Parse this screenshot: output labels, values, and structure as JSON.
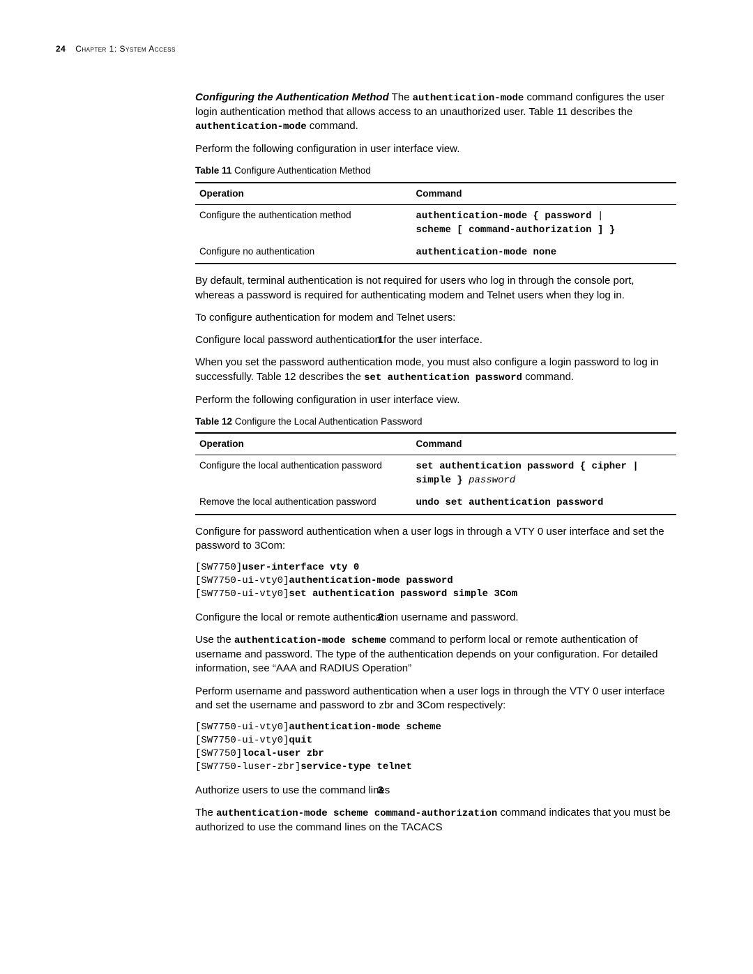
{
  "header": {
    "page_number": "24",
    "chapter": "Chapter 1: System Access"
  },
  "section": {
    "title_bold": "Configuring the Authentication Method",
    "intro_pre": "   The ",
    "intro_cmd": "authentication-mode",
    "intro_post": " command configures the user login authentication method that allows access to an unauthorized user. Table 11 describes the ",
    "intro_cmd2": "authentication-mode",
    "intro_tail": " command.",
    "perform1": "Perform the following configuration in user interface view.",
    "table11_cap_b": "Table 11",
    "table11_cap": "   Configure Authentication Method",
    "table11": {
      "h1": "Operation",
      "h2": "Command",
      "r1c1": "Configure the authentication method",
      "r1c2_1": "authentication-mode { password",
      "r1c2_2": " | ",
      "r1c2_3": "scheme [ command-authorization ] }",
      "r2c1": "Configure no authentication",
      "r2c2": "authentication-mode none"
    },
    "para_default": "By default, terminal authentication is not required for users who log in through the console port, whereas a password is required for authenticating modem and Telnet users when they log in.",
    "para_toconfig": "To configure authentication for modem and Telnet users:",
    "step1_num": "1",
    "step1_line": "Configure local password authentication for the user interface.",
    "step1_p_pre": "When you set the password authentication mode, you must also configure a login password to log in successfully. Table 12 describes the ",
    "step1_p_cmd": "set authentication password",
    "step1_p_post": " command.",
    "perform2": "Perform the following configuration in user interface view.",
    "table12_cap_b": "Table 12",
    "table12_cap": "   Configure the Local Authentication Password",
    "table12": {
      "h1": "Operation",
      "h2": "Command",
      "r1c1": "Configure the local authentication password",
      "r1c2_a": "set authentication password { cipher | simple } ",
      "r1c2_b": "password",
      "r2c1": "Remove the local authentication password",
      "r2c2": "undo set authentication password"
    },
    "para_vty": "Configure for password authentication when a user logs in through a VTY 0 user interface and set the password to 3Com:",
    "code1": {
      "l1a": "[SW7750]",
      "l1b": "user-interface vty 0",
      "l2a": "[SW7750-ui-vty0]",
      "l2b": "authentication-mode password",
      "l3a": "[SW7750-ui-vty0]",
      "l3b": "set authentication password simple 3Com"
    },
    "step2_num": "2",
    "step2_line": "Configure the local or remote authentication username and password.",
    "step2_p_pre": "Use the ",
    "step2_p_cmd": "authentication-mode scheme",
    "step2_p_post": " command to perform local or remote authentication of username and password. The type of the authentication depends on your configuration. For detailed information, see “AAA and RADIUS Operation”",
    "step2_p2": "Perform username and password authentication when a user logs in through the VTY 0 user interface and set the username and password to zbr and 3Com respectively:",
    "code2": {
      "l1a": "[SW7750-ui-vty0]",
      "l1b": "authentication-mode scheme",
      "l2a": "[SW7750-ui-vty0]",
      "l2b": "quit",
      "l3a": "[SW7750]",
      "l3b": "local-user zbr",
      "l4a": "[SW7750-luser-zbr]",
      "l4b": "service-type telnet"
    },
    "step3_num": "3",
    "step3_line": "Authorize users to use the command lines",
    "step3_p_pre": "The ",
    "step3_p_cmd": "authentication-mode scheme command-authorization",
    "step3_p_post": " command indicates that you must be authorized to use the command lines on the TACACS"
  }
}
